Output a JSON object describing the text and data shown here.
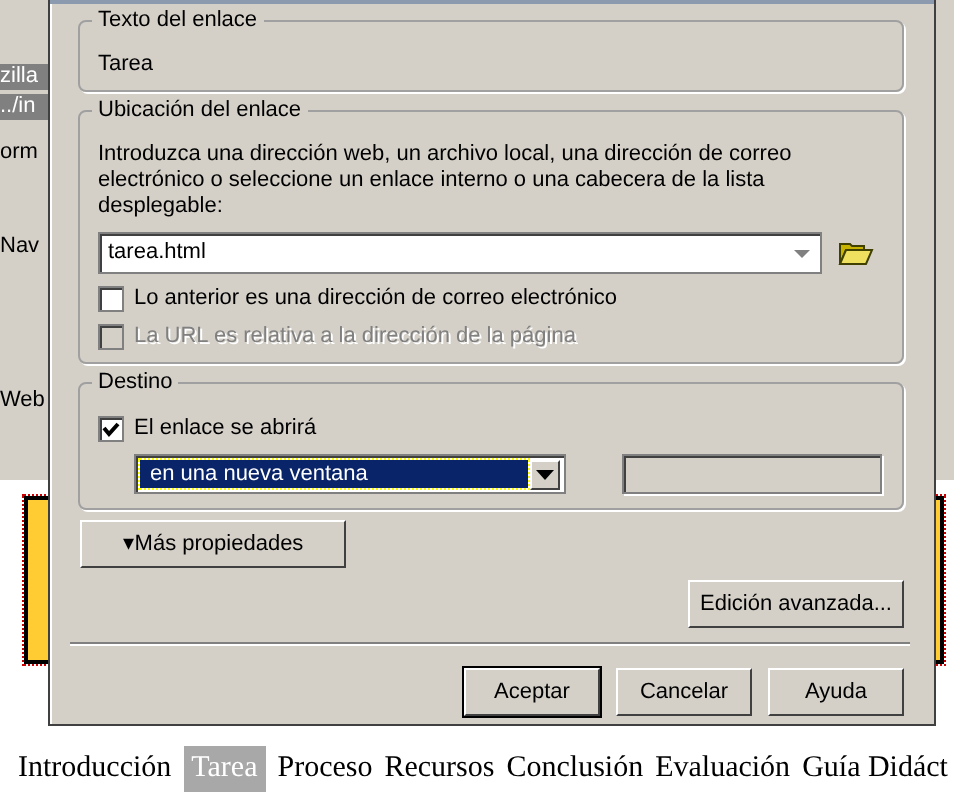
{
  "background": {
    "fragments": [
      {
        "text": "zilla",
        "kind": "bar"
      },
      {
        "text": "../in",
        "kind": "field"
      },
      {
        "text": "orm",
        "kind": "menu"
      },
      {
        "text": "Nav",
        "kind": "tool"
      },
      {
        "text": "Web",
        "kind": "label"
      }
    ]
  },
  "dialog": {
    "link_text": {
      "legend": "Texto del enlace",
      "value": "Tarea"
    },
    "location": {
      "legend": "Ubicación del enlace",
      "description": "Introduzca una dirección web, un archivo local, una dirección de correo electrónico o seleccione un enlace interno o una cabecera de la lista desplegable:",
      "value": "tarea.html",
      "options": [
        {
          "label": "Lo anterior es una dirección de correo electrónico",
          "checked": false,
          "disabled": false
        },
        {
          "label": "La URL es relativa a la dirección de la página",
          "checked": false,
          "disabled": true
        }
      ]
    },
    "target": {
      "legend": "Destino",
      "option": {
        "label": "El enlace se abrirá",
        "checked": true
      },
      "select_value": "en una nueva ventana"
    },
    "more_button": {
      "arrow": "▾",
      "label": "Más propiedades"
    },
    "advanced_button": "Edición avanzada...",
    "buttons": [
      {
        "label": "Aceptar",
        "default": true
      },
      {
        "label": "Cancelar",
        "default": false
      },
      {
        "label": "Ayuda",
        "default": false
      }
    ]
  },
  "nav_links": [
    {
      "label": "Introducción",
      "selected": false
    },
    {
      "label": "Tarea",
      "selected": true
    },
    {
      "label": "Proceso",
      "selected": false
    },
    {
      "label": "Recursos",
      "selected": false
    },
    {
      "label": "Conclusión",
      "selected": false
    },
    {
      "label": "Evaluación",
      "selected": false
    },
    {
      "label": "Guía Didáct",
      "selected": false
    }
  ]
}
